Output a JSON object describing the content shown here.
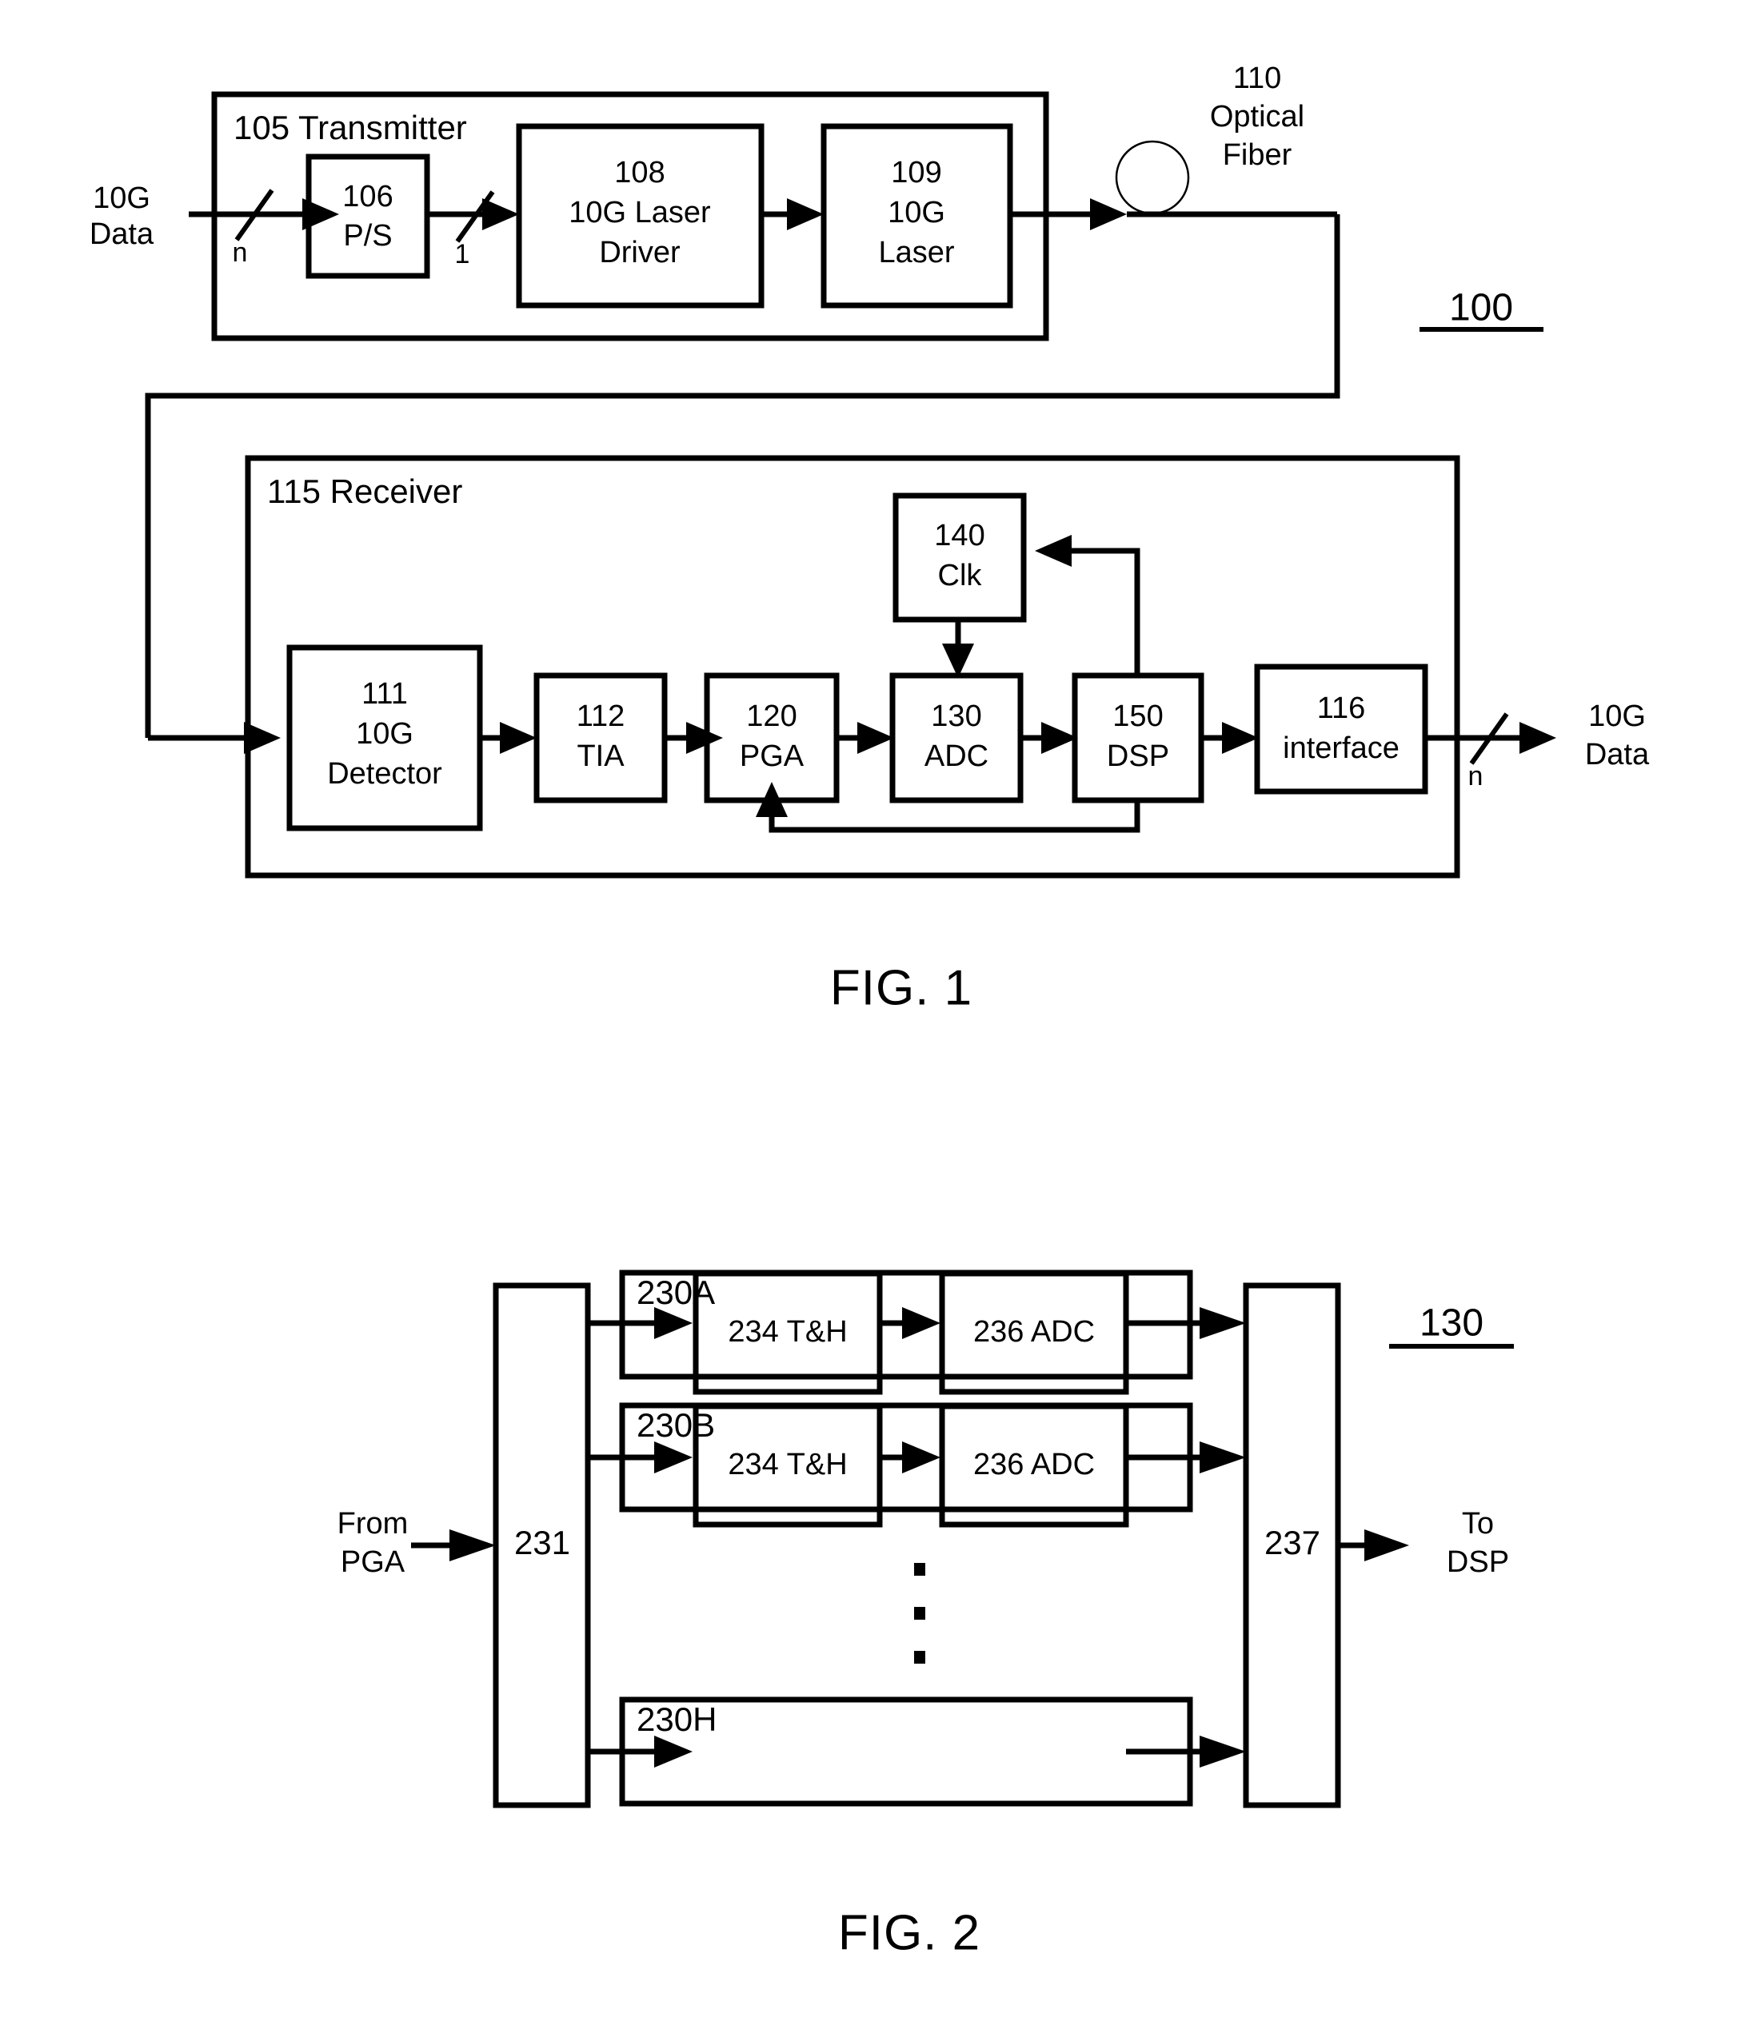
{
  "document": {
    "type": "patent-drawing-sheet",
    "figures": [
      {
        "caption": "FIG. 1",
        "system_ref": "100",
        "blocks": {
          "transmitter": {
            "ref": "105",
            "label": "105 Transmitter"
          },
          "ps": {
            "ref": "106",
            "line1": "106",
            "line2": "P/S"
          },
          "laser_driver": {
            "ref": "108",
            "line1": "108",
            "line2": "10G Laser",
            "line3": "Driver"
          },
          "laser": {
            "ref": "109",
            "line1": "109",
            "line2": "10G",
            "line3": "Laser"
          },
          "optical_fiber": {
            "ref": "110",
            "line1": "110",
            "line2": "Optical",
            "line3": "Fiber"
          },
          "receiver": {
            "ref": "115",
            "label": "115 Receiver"
          },
          "detector": {
            "ref": "111",
            "line1": "111",
            "line2": "10G",
            "line3": "Detector"
          },
          "tia": {
            "ref": "112",
            "line1": "112",
            "line2": "TIA"
          },
          "pga": {
            "ref": "120",
            "line1": "120",
            "line2": "PGA"
          },
          "adc": {
            "ref": "130",
            "line1": "130",
            "line2": "ADC"
          },
          "clk": {
            "ref": "140",
            "line1": "140",
            "line2": "Clk"
          },
          "dsp": {
            "ref": "150",
            "line1": "150",
            "line2": "DSP"
          },
          "interface": {
            "ref": "116",
            "line1": "116",
            "line2": "interface"
          }
        },
        "io": {
          "input_line1": "10G",
          "input_line2": "Data",
          "input_bus_width": "n",
          "serial_bus_width": "1",
          "output_line1": "10G",
          "output_line2": "Data",
          "output_bus_width": "n"
        }
      },
      {
        "caption": "FIG. 2",
        "system_ref": "130",
        "io": {
          "input_line1": "From",
          "input_line2": "PGA",
          "output_line1": "To",
          "output_line2": "DSP"
        },
        "blocks": {
          "demux": {
            "ref": "231"
          },
          "mux": {
            "ref": "237"
          }
        },
        "channels": [
          {
            "ref": "230A",
            "stages": [
              "234 T&H",
              "236 ADC"
            ],
            "empty": false
          },
          {
            "ref": "230B",
            "stages": [
              "234 T&H",
              "236 ADC"
            ],
            "empty": false
          },
          {
            "ref": "230H",
            "stages": [],
            "empty": true
          }
        ],
        "ellipsis": "vertical-dots"
      }
    ]
  }
}
